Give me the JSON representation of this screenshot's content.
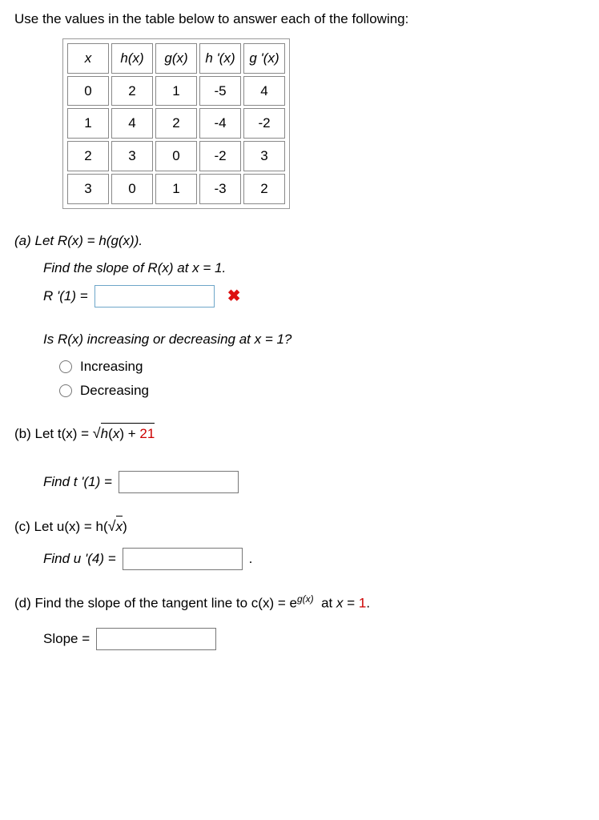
{
  "chart_data": {
    "type": "table",
    "headers": [
      "x",
      "h(x)",
      "g(x)",
      "h '(x)",
      "g '(x)"
    ],
    "rows": [
      [
        "0",
        "2",
        "1",
        "-5",
        "4"
      ],
      [
        "1",
        "4",
        "2",
        "-4",
        "-2"
      ],
      [
        "2",
        "3",
        "0",
        "-2",
        "3"
      ],
      [
        "3",
        "0",
        "1",
        "-3",
        "2"
      ]
    ]
  },
  "intro": "Use the values in the table below to answer each of the following:",
  "parts": {
    "a": {
      "label": "(a) Let R(x) = h(g(x)).",
      "find": "Find the slope of R(x) at x = 1.",
      "eq_prefix": "R '(1) =",
      "input_value": "",
      "question": "Is R(x) increasing or decreasing at x = 1?",
      "opt1": "Increasing",
      "opt2": "Decreasing"
    },
    "b": {
      "label_prefix": "(b) Let  t(x) = ",
      "sqrt_inner": "h(x) + 21",
      "find_prefix": "Find t '(1) ="
    },
    "c": {
      "label_prefix": "(c) Let  u(x) = h(",
      "sqrt_inner": "x",
      "label_suffix": ")",
      "find_prefix": "Find u '(4) =",
      "trailing": "."
    },
    "d": {
      "text_before": "(d) Find the slope of the tangent line to  c(x) = e",
      "exp": "g(x)",
      "text_after": "  at x = 1.",
      "slope_label": "Slope ="
    }
  }
}
